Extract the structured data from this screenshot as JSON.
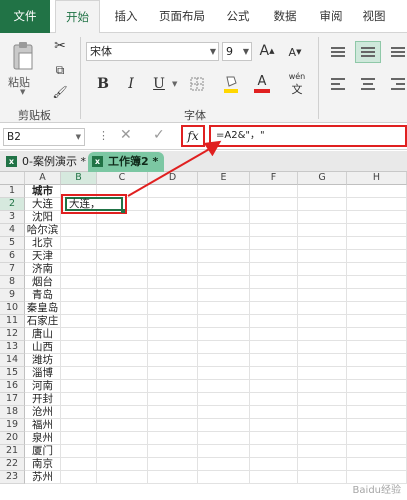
{
  "ribbon_tabs": [
    "文件",
    "开始",
    "插入",
    "页面布局",
    "公式",
    "数据",
    "审阅",
    "视图"
  ],
  "clipboard": {
    "paste_label": "粘贴",
    "group_label": "剪贴板",
    "icons": [
      "paste-icon",
      "cut-icon",
      "copy-icon",
      "format-painter-icon"
    ]
  },
  "font": {
    "name": "宋体",
    "size": "9",
    "grow": "A",
    "shrink": "A",
    "bold": "B",
    "italic": "I",
    "underline": "U",
    "font_color_glyph": "A",
    "wen_label": "wén",
    "group_label": "字体",
    "accent_colors": {
      "highlight": "#ffd700",
      "font_color": "#e02020"
    }
  },
  "formula_bar": {
    "name_box": "B2",
    "fx_label": "fx",
    "formula": "=A2&\"，\""
  },
  "workbooks": [
    {
      "label": "0-案例演示 *",
      "active": false
    },
    {
      "label": "工作簿2 *",
      "active": true
    }
  ],
  "columns": [
    "A",
    "B",
    "C",
    "D",
    "E",
    "F",
    "G",
    "H"
  ],
  "rows": [
    {
      "n": "1",
      "a": "城市",
      "bold": true
    },
    {
      "n": "2",
      "a": "大连"
    },
    {
      "n": "3",
      "a": "沈阳"
    },
    {
      "n": "4",
      "a": "哈尔滨"
    },
    {
      "n": "5",
      "a": "北京"
    },
    {
      "n": "6",
      "a": "天津"
    },
    {
      "n": "7",
      "a": "济南"
    },
    {
      "n": "8",
      "a": "烟台"
    },
    {
      "n": "9",
      "a": "青岛"
    },
    {
      "n": "10",
      "a": "秦皇岛"
    },
    {
      "n": "11",
      "a": "石家庄"
    },
    {
      "n": "12",
      "a": "唐山"
    },
    {
      "n": "13",
      "a": "山西"
    },
    {
      "n": "14",
      "a": "潍坊"
    },
    {
      "n": "15",
      "a": "淄博"
    },
    {
      "n": "16",
      "a": "河南"
    },
    {
      "n": "17",
      "a": "开封"
    },
    {
      "n": "18",
      "a": "沧州"
    },
    {
      "n": "19",
      "a": "福州"
    },
    {
      "n": "20",
      "a": "泉州"
    },
    {
      "n": "21",
      "a": "厦门"
    },
    {
      "n": "22",
      "a": "南京"
    },
    {
      "n": "23",
      "a": "苏州"
    }
  ],
  "active_cell": {
    "ref": "B2",
    "value": "大连，"
  },
  "colors": {
    "excel_green": "#217346",
    "annotation_red": "#e02020",
    "workbook_tab": "#7cc7a3"
  },
  "watermark": "Baidu经验"
}
